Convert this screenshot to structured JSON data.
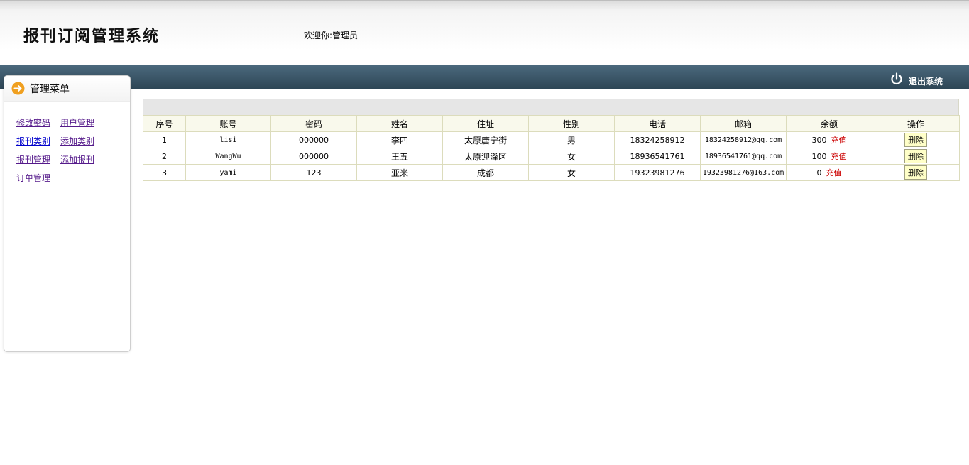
{
  "header": {
    "app_title": "报刊订阅管理系统",
    "welcome": "欢迎你:管理员",
    "logout_label": "退出系统"
  },
  "sidebar": {
    "title": "管理菜单",
    "items": [
      {
        "label": "修改密码"
      },
      {
        "label": "用户管理"
      },
      {
        "label": "报刊类别"
      },
      {
        "label": "添加类别"
      },
      {
        "label": "报刊管理"
      },
      {
        "label": "添加报刊"
      },
      {
        "label": "订单管理"
      }
    ]
  },
  "table": {
    "columns": [
      "序号",
      "账号",
      "密码",
      "姓名",
      "住址",
      "性别",
      "电话",
      "邮箱",
      "余额",
      "操作"
    ],
    "recharge_label": "充值",
    "delete_label": "删除",
    "rows": [
      {
        "id": "1",
        "account": "lisi",
        "password": "000000",
        "name": "李四",
        "address": "太原唐宁街",
        "gender": "男",
        "phone": "18324258912",
        "email": "18324258912@qq.com",
        "balance": "300"
      },
      {
        "id": "2",
        "account": "WangWu",
        "password": "000000",
        "name": "王五",
        "address": "太原迎泽区",
        "gender": "女",
        "phone": "18936541761",
        "email": "18936541761@qq.com",
        "balance": "100"
      },
      {
        "id": "3",
        "account": "yami",
        "password": "123",
        "name": "亚米",
        "address": "成都",
        "gender": "女",
        "phone": "19323981276",
        "email": "19323981276@163.com",
        "balance": "0"
      }
    ]
  },
  "colors": {
    "topbar": "#3a5568",
    "accent_orange": "#f0a020",
    "recharge_red": "#cc0000"
  }
}
